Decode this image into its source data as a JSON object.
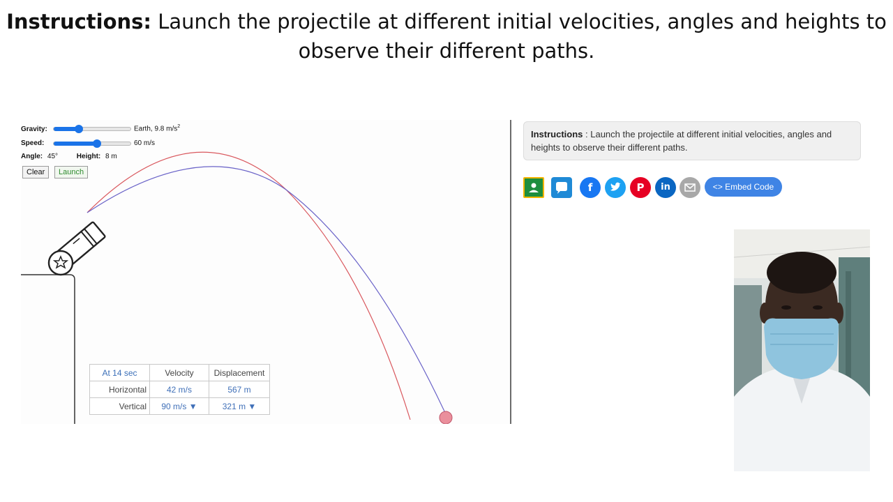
{
  "headline": {
    "bold": "Instructions:",
    "text": " Launch the projectile at different initial velocities, angles and heights to observe their different paths."
  },
  "controls": {
    "gravity_label": "Gravity:",
    "gravity_value": "Earth, 9.8 m/s",
    "gravity_sup": "2",
    "gravity_level": 0.32,
    "speed_label": "Speed:",
    "speed_value": "60 m/s",
    "speed_level": 0.55,
    "angle_label": "Angle:",
    "angle_value": "45°",
    "height_label": "Height:",
    "height_value": "8 m",
    "clear_label": "Clear",
    "launch_label": "Launch"
  },
  "table": {
    "corner": "At 14 sec",
    "col1": "Velocity",
    "col2": "Displacement",
    "rows": [
      {
        "label": "Horizontal",
        "velocity": "42 m/s",
        "displacement": "567 m"
      },
      {
        "label": "Vertical",
        "velocity": "90 m/s ▼",
        "displacement": "321 m ▼"
      }
    ]
  },
  "info_box": {
    "bold": "Instructions",
    "text": " : Launch the projectile at different initial velocities, angles and heights to observe their different paths."
  },
  "share": {
    "icons": [
      {
        "name": "google-classroom-icon",
        "color": "#1e8e3e"
      },
      {
        "name": "chat-icon",
        "color": "#1f8ad6"
      },
      {
        "name": "facebook-icon",
        "color": "#1877f2"
      },
      {
        "name": "twitter-icon",
        "color": "#1da1f2"
      },
      {
        "name": "pinterest-icon",
        "color": "#e60023"
      },
      {
        "name": "linkedin-icon",
        "color": "#0a66c2"
      },
      {
        "name": "email-icon",
        "color": "#a8a8a8"
      }
    ],
    "embed_label": "Embed Code"
  },
  "colors": {
    "trajectory_red": "#d9575d",
    "trajectory_blue": "#6a63c8",
    "projectile": "#ea8f9c"
  }
}
